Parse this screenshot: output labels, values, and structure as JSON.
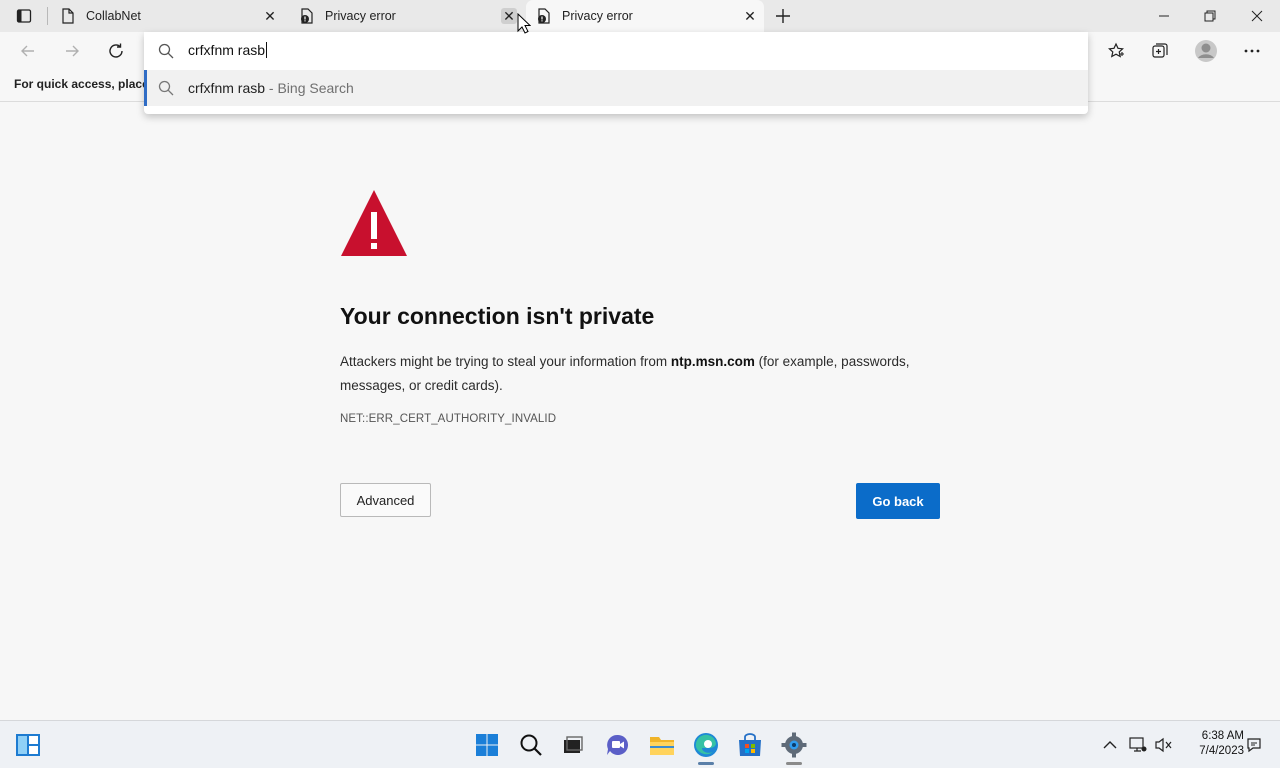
{
  "tabs": [
    {
      "title": "CollabNet",
      "active": false
    },
    {
      "title": "Privacy error",
      "active": false
    },
    {
      "title": "Privacy error",
      "active": true
    }
  ],
  "window_controls": {
    "minimize": "–",
    "restore": "❐",
    "close": "✕"
  },
  "favorites_bar": {
    "text": "For quick access, place y"
  },
  "omnibox": {
    "query": "crfxfnm rasb",
    "suggestion": {
      "text": "crfxfnm rasb",
      "source": " - Bing Search"
    }
  },
  "error_page": {
    "title": "Your connection isn't private",
    "desc_before": "Attackers might be trying to steal your information from ",
    "desc_host": "ntp.msn.com",
    "desc_after": " (for example, passwords, messages, or credit cards).",
    "code": "NET::ERR_CERT_AUTHORITY_INVALID",
    "advanced_label": "Advanced",
    "go_back_label": "Go back"
  },
  "taskbar": {
    "time": "6:38 AM",
    "date": "7/4/2023"
  },
  "colors": {
    "accent": "#0b6cc9",
    "warning": "#c8102e",
    "suggestion_bar": "#2f6cc5"
  }
}
